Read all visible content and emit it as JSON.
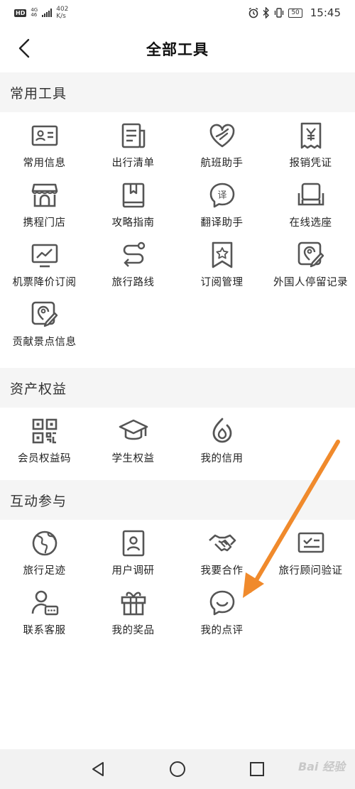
{
  "status": {
    "hd": "HD",
    "net_type": "4G",
    "net_sub": "46",
    "speed_value": "402",
    "speed_unit": "K/s",
    "battery": "50",
    "time": "15:45"
  },
  "header": {
    "title": "全部工具"
  },
  "sections": [
    {
      "title": "常用工具",
      "items": [
        {
          "label": "常用信息",
          "icon": "id-card-icon"
        },
        {
          "label": "出行清单",
          "icon": "checklist-icon"
        },
        {
          "label": "航班助手",
          "icon": "flight-heart-icon"
        },
        {
          "label": "报销凭证",
          "icon": "receipt-icon"
        },
        {
          "label": "携程门店",
          "icon": "store-icon"
        },
        {
          "label": "攻略指南",
          "icon": "guide-book-icon"
        },
        {
          "label": "翻译助手",
          "icon": "translate-icon"
        },
        {
          "label": "在线选座",
          "icon": "seat-icon"
        },
        {
          "label": "机票降价订阅",
          "icon": "price-chart-icon"
        },
        {
          "label": "旅行路线",
          "icon": "route-icon"
        },
        {
          "label": "订阅管理",
          "icon": "bookmark-star-icon"
        },
        {
          "label": "外国人停留记录",
          "icon": "pin-pencil-icon"
        },
        {
          "label": "贡献景点信息",
          "icon": "pin-pencil-icon"
        }
      ]
    },
    {
      "title": "资产权益",
      "items": [
        {
          "label": "会员权益码",
          "icon": "qr-code-icon"
        },
        {
          "label": "学生权益",
          "icon": "graduation-cap-icon"
        },
        {
          "label": "我的信用",
          "icon": "drop-icon"
        }
      ]
    },
    {
      "title": "互动参与",
      "items": [
        {
          "label": "旅行足迹",
          "icon": "globe-icon"
        },
        {
          "label": "用户调研",
          "icon": "survey-icon"
        },
        {
          "label": "我要合作",
          "icon": "handshake-icon"
        },
        {
          "label": "旅行顾问验证",
          "icon": "verify-card-icon"
        },
        {
          "label": "联系客服",
          "icon": "customer-service-icon"
        },
        {
          "label": "我的奖品",
          "icon": "gift-icon"
        },
        {
          "label": "我的点评",
          "icon": "comment-icon"
        }
      ]
    }
  ],
  "watermark": "Bai 经验",
  "colors": {
    "icon": "#555555",
    "section_bg": "#f5f5f5",
    "annotation_arrow": "#f08a2c"
  }
}
